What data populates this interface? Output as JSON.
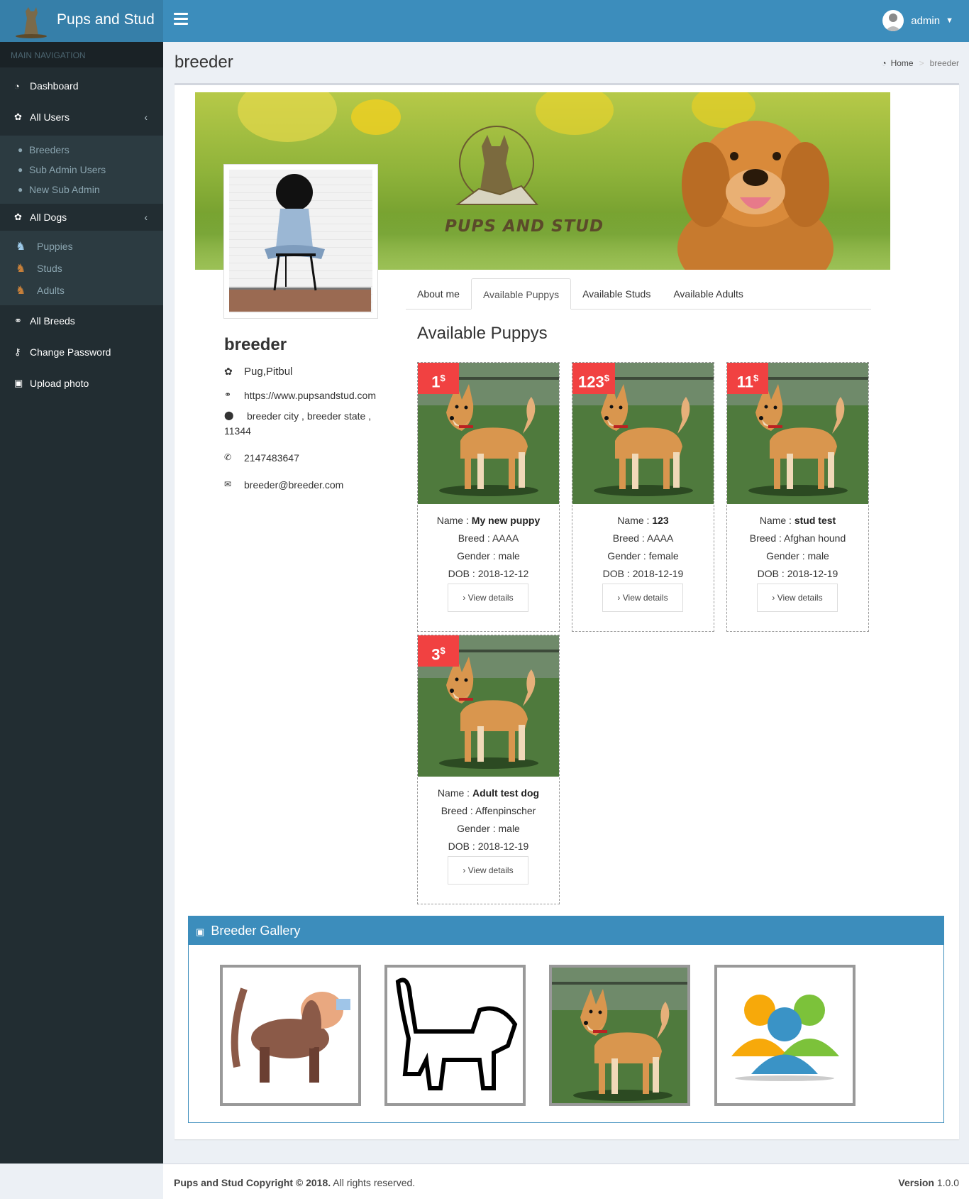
{
  "app": {
    "title": "Pups and Stud",
    "logo_text": "PUPS AND STUD"
  },
  "header": {
    "user_name": "admin"
  },
  "sidebar": {
    "header": "MAIN NAVIGATION",
    "dashboard": "Dashboard",
    "all_users": "All Users",
    "users_sub": [
      "Breeders",
      "Sub Admin Users",
      "New Sub Admin"
    ],
    "all_dogs": "All Dogs",
    "dogs_sub": [
      "Puppies",
      "Studs",
      "Adults"
    ],
    "all_breeds": "All Breeds",
    "change_password": "Change Password",
    "upload_photo": "Upload photo"
  },
  "page": {
    "title": "breeder",
    "breadcrumb_home": "Home",
    "breadcrumb_current": "breeder"
  },
  "profile": {
    "name": "breeder",
    "breeds": "Pug,Pitbul",
    "website": "https://www.pupsandstud.com",
    "address_line1": "breeder city , breeder state ,",
    "address_line2": "11344",
    "phone": "2147483647",
    "email": "breeder@breeder.com"
  },
  "tabs": [
    "About me",
    "Available Puppys",
    "Available Studs",
    "Available Adults"
  ],
  "active_tab": "Available Puppys",
  "section_title": "Available Puppys",
  "labels": {
    "name": "Name",
    "breed": "Breed",
    "gender": "Gender",
    "dob": "DOB",
    "view_details": "View details",
    "currency": "$"
  },
  "dogs": [
    {
      "price": "1",
      "name": "My new puppy",
      "breed": "AAAA",
      "gender": "male",
      "dob": "2018-12-12"
    },
    {
      "price": "123",
      "name": "123",
      "breed": "AAAA",
      "gender": "female",
      "dob": "2018-12-19"
    },
    {
      "price": "11",
      "name": "stud test",
      "breed": "Afghan hound",
      "gender": "male",
      "dob": "2018-12-19"
    },
    {
      "price": "3",
      "name": "Adult test dog",
      "breed": "Affenpinscher",
      "gender": "male",
      "dob": "2018-12-19"
    }
  ],
  "gallery": {
    "title": "Breeder Gallery",
    "items": [
      "dog-cartoon",
      "dog-outline",
      "dog-photo",
      "users-icon"
    ]
  },
  "footer": {
    "brand": "Pups and Stud",
    "copyright": "Copyright © 2018.",
    "rights": "All rights reserved.",
    "version_label": "Version",
    "version": "1.0.0"
  },
  "colors": {
    "header": "#3c8dbc",
    "sidebar": "#222d32",
    "price_badge": "#f14141",
    "gallery_header": "#3c8dbc"
  }
}
